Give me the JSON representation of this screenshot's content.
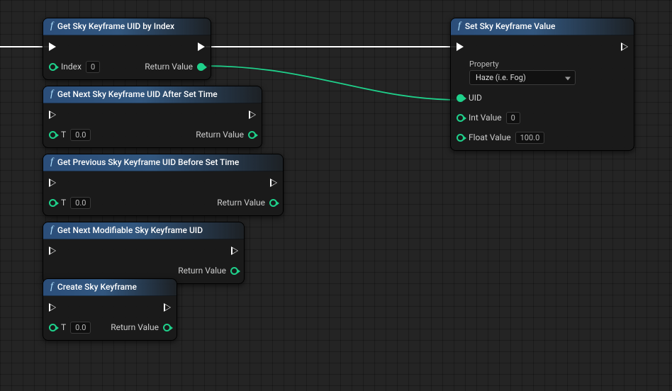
{
  "nodes": {
    "n1": {
      "title": "Get Sky Keyframe UID by Index",
      "index_label": "Index",
      "index_value": "0",
      "return_label": "Return Value"
    },
    "n2": {
      "title": "Get Next Sky Keyframe UID After Set Time",
      "t_label": "T",
      "t_value": "0.0",
      "return_label": "Return Value"
    },
    "n3": {
      "title": "Get Previous Sky Keyframe UID Before Set Time",
      "t_label": "T",
      "t_value": "0.0",
      "return_label": "Return Value"
    },
    "n4": {
      "title": "Get Next Modifiable Sky Keyframe UID",
      "return_label": "Return Value"
    },
    "n5": {
      "title": "Create Sky Keyframe",
      "t_label": "T",
      "t_value": "0.0",
      "return_label": "Return Value"
    },
    "n6": {
      "title": "Set Sky Keyframe Value",
      "property_label": "Property",
      "property_value": "Haze (i.e. Fog)",
      "uid_label": "UID",
      "int_label": "Int Value",
      "int_value": "0",
      "float_label": "Float Value",
      "float_value": "100.0"
    }
  }
}
